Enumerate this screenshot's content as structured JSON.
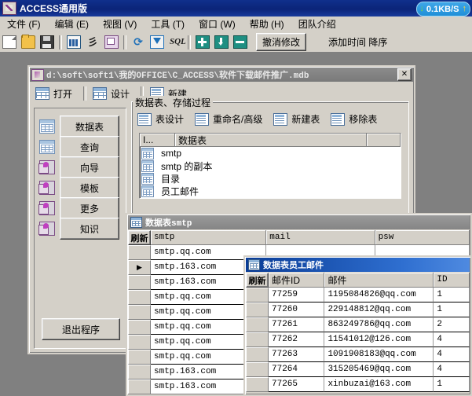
{
  "app": {
    "title": "ACCESS通用版",
    "title_icon": "access-app-icon",
    "network": {
      "down_icon": "arrow-down-icon",
      "speed": "0.1KB/S",
      "up_icon": "arrow-up-icon"
    }
  },
  "menubar": {
    "items": [
      {
        "label": "文件 (F)",
        "name": "menu-file"
      },
      {
        "label": "编辑 (E)",
        "name": "menu-edit"
      },
      {
        "label": "视图 (V)",
        "name": "menu-view"
      },
      {
        "label": "工具 (T)",
        "name": "menu-tools"
      },
      {
        "label": "窗口 (W)",
        "name": "menu-window"
      },
      {
        "label": "帮助 (H)",
        "name": "menu-help"
      },
      {
        "label": "团队介绍",
        "name": "menu-team"
      }
    ]
  },
  "toolbar": {
    "icons": [
      {
        "name": "new-document-icon",
        "cls": "ico-doc"
      },
      {
        "name": "open-folder-icon",
        "cls": "ico-folder"
      },
      {
        "name": "save-icon",
        "cls": "ico-save"
      },
      {
        "name": "chart-icon",
        "cls": "ico-chart"
      },
      {
        "name": "sort-icon",
        "cls": "ico-sort"
      },
      {
        "name": "export-icon",
        "cls": "ico-export"
      },
      {
        "name": "refresh-icon",
        "cls": "ico-refresh"
      },
      {
        "name": "filter-icon",
        "cls": "ico-filter"
      },
      {
        "name": "sql-icon",
        "cls": "ico-sql"
      },
      {
        "name": "add-record-icon",
        "cls": "ico-plus"
      },
      {
        "name": "import-icon",
        "cls": "ico-imp"
      },
      {
        "name": "delete-record-icon",
        "cls": "ico-minus"
      }
    ],
    "undo_label": "撤消修改",
    "sort_label": "添加时间  降序"
  },
  "db_window": {
    "title": "d:\\soft\\soft1\\我的OFFICE\\C_ACCESS\\软件下载邮件推广.mdb",
    "close_label": "✕",
    "toolbar": [
      {
        "label": "打开",
        "name": "db-open-button"
      },
      {
        "label": "设计",
        "name": "db-design-button"
      },
      {
        "label": "新建",
        "name": "db-new-button"
      }
    ],
    "nav_buttons": [
      {
        "label": "数据表",
        "icon": "table-icon"
      },
      {
        "label": "查询",
        "icon": "table-icon"
      },
      {
        "label": "向导",
        "icon": "magic-wand-icon"
      },
      {
        "label": "模板",
        "icon": "magic-wand-icon"
      },
      {
        "label": "更多",
        "icon": "magic-wand-icon"
      },
      {
        "label": "知识",
        "icon": "magic-wand-icon"
      }
    ],
    "exit_label": "退出程序",
    "group_legend": "数据表、存储过程",
    "group_toolbar": [
      {
        "label": "表设计",
        "name": "table-design-button"
      },
      {
        "label": "重命名/高级",
        "name": "rename-advanced-button"
      },
      {
        "label": "新建表",
        "name": "new-table-button"
      },
      {
        "label": "移除表",
        "name": "remove-table-button"
      }
    ],
    "list_headers": [
      "I...",
      "数据表",
      ""
    ],
    "list_rows": [
      "smtp",
      "smtp 的副本",
      "目录",
      "员工邮件"
    ]
  },
  "smtp_window": {
    "title_prefix": "数据表",
    "title_suffix": "smtp",
    "refresh_label": "刷新",
    "headers": [
      "smtp",
      "mail",
      "psw"
    ],
    "rows": [
      {
        "sel": "",
        "smtp": "smtp.qq.com"
      },
      {
        "sel": "▶",
        "smtp": "smtp.163.com"
      },
      {
        "sel": "",
        "smtp": "smtp.163.com"
      },
      {
        "sel": "",
        "smtp": "smtp.qq.com"
      },
      {
        "sel": "",
        "smtp": "smtp.qq.com"
      },
      {
        "sel": "",
        "smtp": "smtp.qq.com"
      },
      {
        "sel": "",
        "smtp": "smtp.qq.com"
      },
      {
        "sel": "",
        "smtp": "smtp.qq.com"
      },
      {
        "sel": "",
        "smtp": "smtp.163.com"
      },
      {
        "sel": "",
        "smtp": "smtp.163.com"
      }
    ]
  },
  "emp_window": {
    "title": "数据表员工邮件",
    "refresh_label": "刷新",
    "headers": [
      "邮件ID",
      "邮件",
      "ID"
    ],
    "rows": [
      {
        "id": "77259",
        "mail": "1195084826@qq.com",
        "uid": "1"
      },
      {
        "id": "77260",
        "mail": "229148812@qq.com",
        "uid": "1"
      },
      {
        "id": "77261",
        "mail": "863249786@qq.com",
        "uid": "2"
      },
      {
        "id": "77262",
        "mail": "11541012@126.com",
        "uid": "4"
      },
      {
        "id": "77263",
        "mail": "1091908183@qq.com",
        "uid": "4"
      },
      {
        "id": "77264",
        "mail": "315205469@qq.com",
        "uid": "4"
      },
      {
        "id": "77265",
        "mail": "xinbuzai@163.com",
        "uid": "1"
      }
    ]
  },
  "colors": {
    "titlebar": "#0b2478",
    "active_window_title": "#0a3c96",
    "inactive_window_title": "#8c8c8c",
    "face": "#d4d0c8",
    "mdi_background": "#808080",
    "badge": "#2f97dc"
  }
}
